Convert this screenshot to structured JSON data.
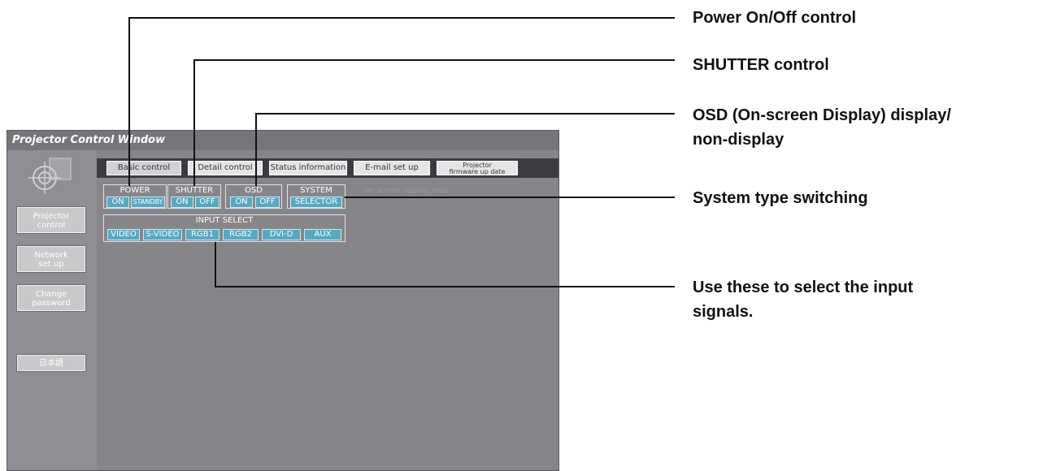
{
  "window": {
    "title": "Projector Control Window",
    "sidebar": [
      "Projector control",
      "Network set up",
      "Change password",
      "日本語"
    ],
    "tabs": [
      "Basic control",
      "Detail control",
      "Status information",
      "E-mail set up",
      "Projector firmware up date"
    ],
    "groups": {
      "power": {
        "label": "POWER",
        "buttons": [
          "ON",
          "STANDBY"
        ]
      },
      "shutter": {
        "label": "SHUTTER",
        "buttons": [
          "ON",
          "OFF"
        ]
      },
      "osd": {
        "label": "OSD",
        "buttons": [
          "ON",
          "OFF"
        ]
      },
      "system": {
        "label": "SYSTEM",
        "buttons": [
          "SELECTOR"
        ]
      },
      "input": {
        "label": "INPUT SELECT",
        "buttons": [
          "VIDEO",
          "S-VIDEO",
          "RGB1",
          "RGB2",
          "DVI-D",
          "AUX"
        ]
      }
    },
    "status_text": "on screen display area"
  },
  "callouts": [
    "Power On/Off control",
    "SHUTTER control",
    "OSD (On-screen Display) display/",
    "non-display",
    "System type switching",
    "Use these to select the input",
    "signals."
  ]
}
